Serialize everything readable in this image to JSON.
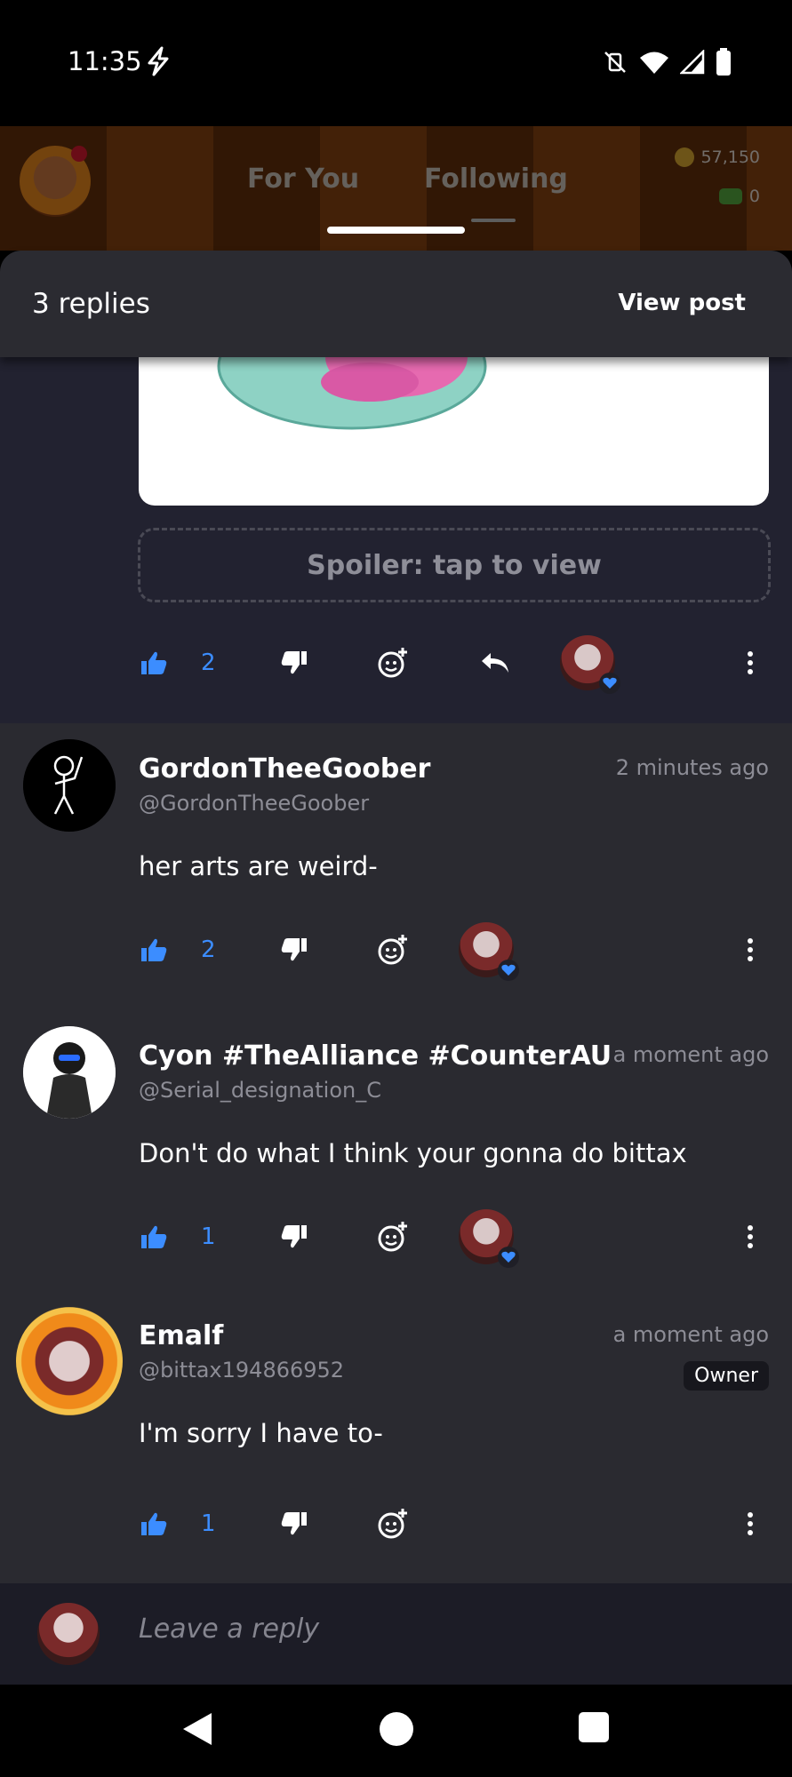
{
  "status_bar": {
    "time": "11:35"
  },
  "app_header": {
    "tabs": [
      {
        "label": "For You"
      },
      {
        "label": "Following"
      }
    ],
    "coins": "57,150",
    "money": "0"
  },
  "sheet": {
    "title": "3 replies",
    "view_post_label": "View post"
  },
  "original_post": {
    "spoiler_label": "Spoiler: tap to view",
    "like_count": "2"
  },
  "replies": [
    {
      "name": "GordonTheeGoober",
      "handle": "@GordonTheeGoober",
      "time": "2 minutes ago",
      "text": "her arts are weird-",
      "like_count": "2"
    },
    {
      "name": "Cyon #TheAlliance #CounterAU",
      "handle": "@Serial_designation_C",
      "time": "a moment ago",
      "text": "Don't do what I think your gonna do bittax",
      "like_count": "1"
    },
    {
      "name": "Emalf",
      "handle": "@bittax194866952",
      "time": "a moment ago",
      "badge": "Owner",
      "text": "I'm sorry I have to-",
      "like_count": "1"
    }
  ],
  "composer": {
    "placeholder": "Leave a reply"
  },
  "colors": {
    "accent_blue": "#3c8dff",
    "sheet_bg": "#2a2a30",
    "composer_bg": "#1c1c26"
  }
}
